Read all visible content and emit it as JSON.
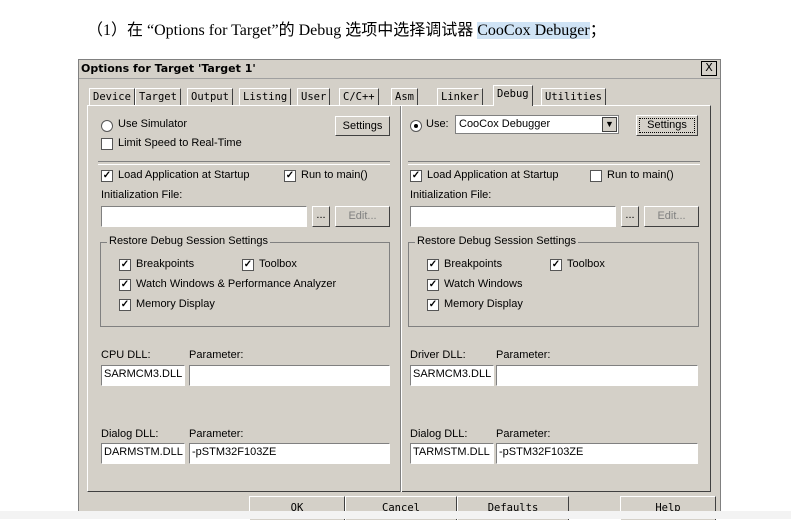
{
  "document": {
    "prefix": "（1）在 “Options for Target”的 Debug 选项中选择调试器 ",
    "highlight": "CooCox Debuger",
    "suffix": "；"
  },
  "dialog": {
    "title": "Options for Target 'Target 1'",
    "close": "X",
    "tabs": [
      "Device",
      "Target",
      "Output",
      "Listing",
      "User",
      "C/C++",
      "Asm",
      "Linker",
      "Debug",
      "Utilities"
    ],
    "active_tab": "Debug"
  },
  "left": {
    "use_simulator": "Use Simulator",
    "limit_speed": "Limit Speed to Real-Time",
    "settings": "Settings",
    "load_app": "Load Application at Startup",
    "run_to_main": "Run to main()",
    "init_file": "Initialization File:",
    "browse": "...",
    "edit": "Edit...",
    "restore_group": "Restore Debug Session Settings",
    "breakpoints": "Breakpoints",
    "toolbox": "Toolbox",
    "watch": "Watch Windows & Performance Analyzer",
    "memory": "Memory Display",
    "cpu_dll_label": "CPU DLL:",
    "param_label": "Parameter:",
    "cpu_dll": "SARMCM3.DLL",
    "cpu_param": "",
    "dialog_dll_label": "Dialog DLL:",
    "dialog_param_label": "Parameter:",
    "dialog_dll": "DARMSTM.DLL",
    "dialog_param": "-pSTM32F103ZE"
  },
  "right": {
    "use": "Use:",
    "debugger": "CooCox Debugger",
    "settings": "Settings",
    "load_app": "Load Application at Startup",
    "run_to_main": "Run to main()",
    "init_file": "Initialization File:",
    "browse": "...",
    "edit": "Edit...",
    "restore_group": "Restore Debug Session Settings",
    "breakpoints": "Breakpoints",
    "toolbox": "Toolbox",
    "watch": "Watch Windows",
    "memory": "Memory Display",
    "driver_dll_label": "Driver DLL:",
    "param_label": "Parameter:",
    "driver_dll": "SARMCM3.DLL",
    "driver_param": "",
    "dialog_dll_label": "Dialog DLL:",
    "dialog_param_label": "Parameter:",
    "dialog_dll": "TARMSTM.DLL",
    "dialog_param": "-pSTM32F103ZE"
  },
  "buttons": {
    "ok": "OK",
    "cancel": "Cancel",
    "defaults": "Defaults",
    "help": "Help"
  },
  "checks": {
    "left_limit_speed": false,
    "left_load_app": true,
    "left_run_to_main": true,
    "left_breakpoints": true,
    "left_toolbox": true,
    "left_watch": true,
    "left_memory": true,
    "right_load_app": true,
    "right_run_to_main": false,
    "right_breakpoints": true,
    "right_toolbox": true,
    "right_watch": true,
    "right_memory": true
  }
}
